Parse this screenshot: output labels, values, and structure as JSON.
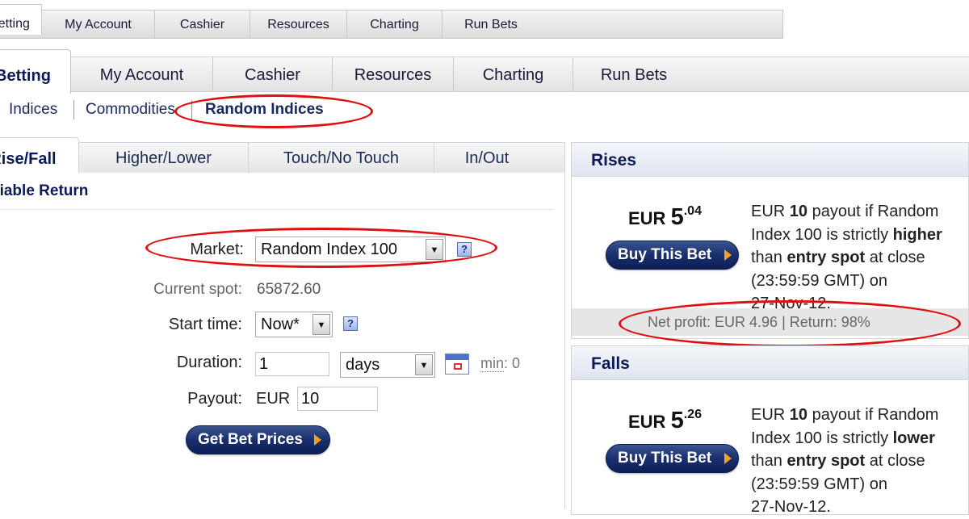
{
  "nav_small": {
    "tabs": [
      "Betting",
      "My Account",
      "Cashier",
      "Resources",
      "Charting",
      "Run Bets"
    ],
    "active": "Betting"
  },
  "nav_big": {
    "tabs": [
      "Betting",
      "My Account",
      "Cashier",
      "Resources",
      "Charting",
      "Run Bets"
    ],
    "active": "Betting"
  },
  "subnav": {
    "items": [
      "Indices",
      "Commodities",
      "Random Indices"
    ],
    "active": "Random Indices"
  },
  "bet_tabs": {
    "tabs": [
      "Rise/Fall",
      "Higher/Lower",
      "Touch/No Touch",
      "In/Out"
    ],
    "active": "Rise/Fall"
  },
  "form": {
    "section_title": "Variable Return",
    "market_label": "Market:",
    "market_value": "Random Index 100",
    "current_spot_label": "Current spot:",
    "current_spot_value": "65872.60",
    "start_time_label": "Start time:",
    "start_time_value": "Now*",
    "duration_label": "Duration:",
    "duration_value": "1",
    "duration_unit": "days",
    "min_label": "min",
    "min_value": ": 0",
    "payout_label": "Payout:",
    "payout_currency": "EUR",
    "payout_value": "10",
    "get_prices_label": "Get Bet Prices",
    "help_glyph": "?"
  },
  "rises": {
    "title": "Rises",
    "currency": "EUR",
    "price_int": "5",
    "price_dec": ".04",
    "buy_label": "Buy This Bet",
    "desc_lines": [
      [
        "EUR ",
        "10",
        " payout if Random"
      ],
      [
        "Index 100 is strictly ",
        "higher",
        ""
      ],
      [
        "than ",
        "entry spot",
        " at close"
      ],
      [
        "(23:59:59 GMT) on",
        "",
        ""
      ],
      [
        "27-Nov-12.",
        "",
        ""
      ]
    ],
    "net_profit": "Net profit: EUR 4.96 | Return: 98%"
  },
  "falls": {
    "title": "Falls",
    "currency": "EUR",
    "price_int": "5",
    "price_dec": ".26",
    "buy_label": "Buy This Bet",
    "desc_lines": [
      [
        "EUR ",
        "10",
        " payout if Random"
      ],
      [
        "Index 100 is strictly ",
        "lower",
        ""
      ],
      [
        "than ",
        "entry spot",
        " at close"
      ],
      [
        "(23:59:59 GMT) on",
        "",
        ""
      ],
      [
        "27-Nov-12.",
        "",
        ""
      ]
    ]
  },
  "colors": {
    "annotation": "#e01010",
    "brand_navy": "#0d1a5a",
    "button_arrow": "#f5a020"
  }
}
